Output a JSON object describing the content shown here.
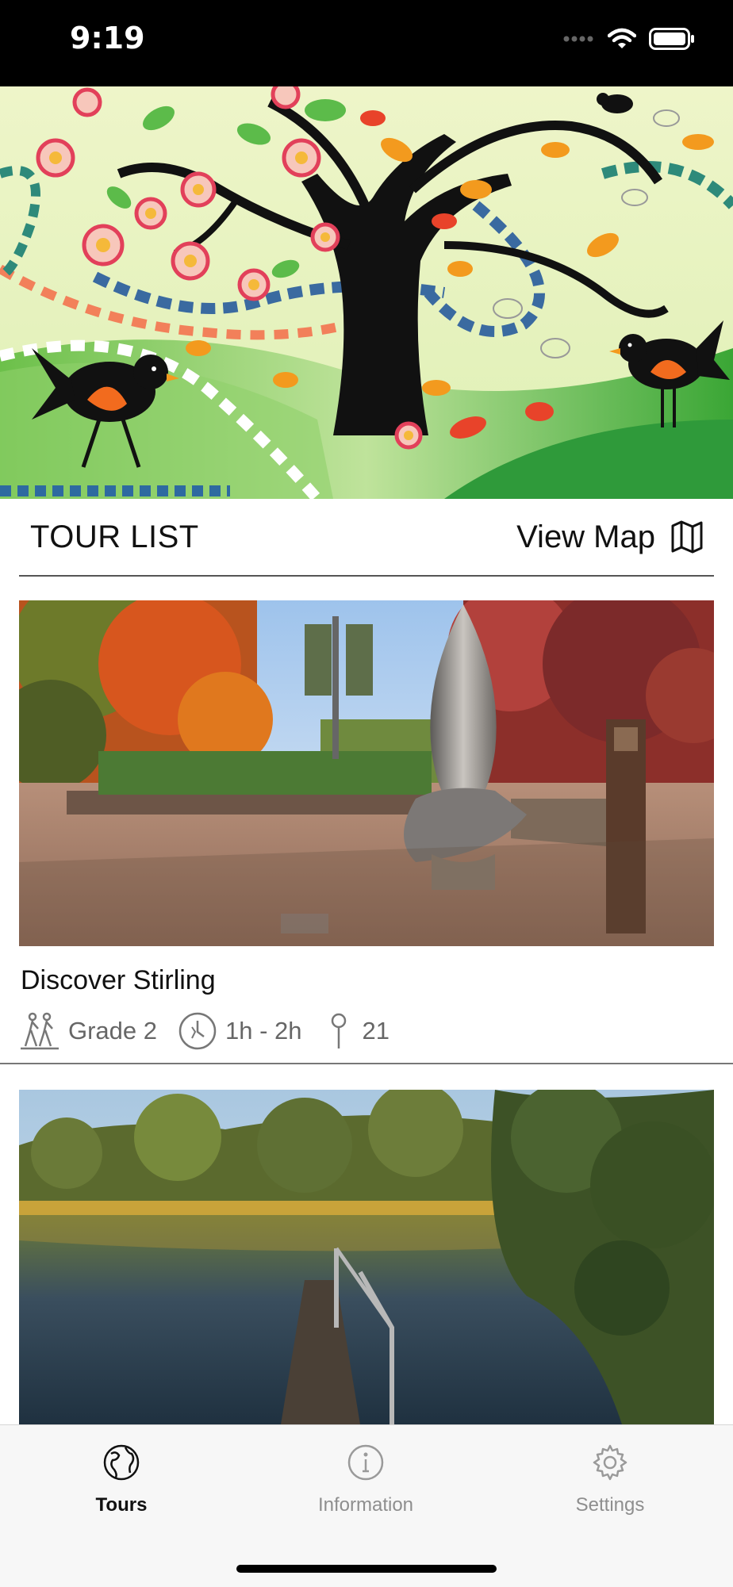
{
  "status_bar": {
    "time": "9:19"
  },
  "header": {
    "title": "TOUR LIST",
    "view_map_label": "View Map"
  },
  "tours": [
    {
      "name": "Discover Stirling",
      "grade": "Grade 2",
      "duration": "1h - 2h",
      "stops": "21"
    },
    {
      "name": "",
      "grade": "",
      "duration": "",
      "stops": ""
    }
  ],
  "tab_bar": {
    "tabs": [
      {
        "label": "Tours",
        "icon": "globe-icon",
        "active": true
      },
      {
        "label": "Information",
        "icon": "info-icon",
        "active": false
      },
      {
        "label": "Settings",
        "icon": "gear-icon",
        "active": false
      }
    ]
  },
  "colors": {
    "status_bar": "#000000",
    "active_tab": "#111111",
    "inactive_tab": "#8e8e8e"
  }
}
